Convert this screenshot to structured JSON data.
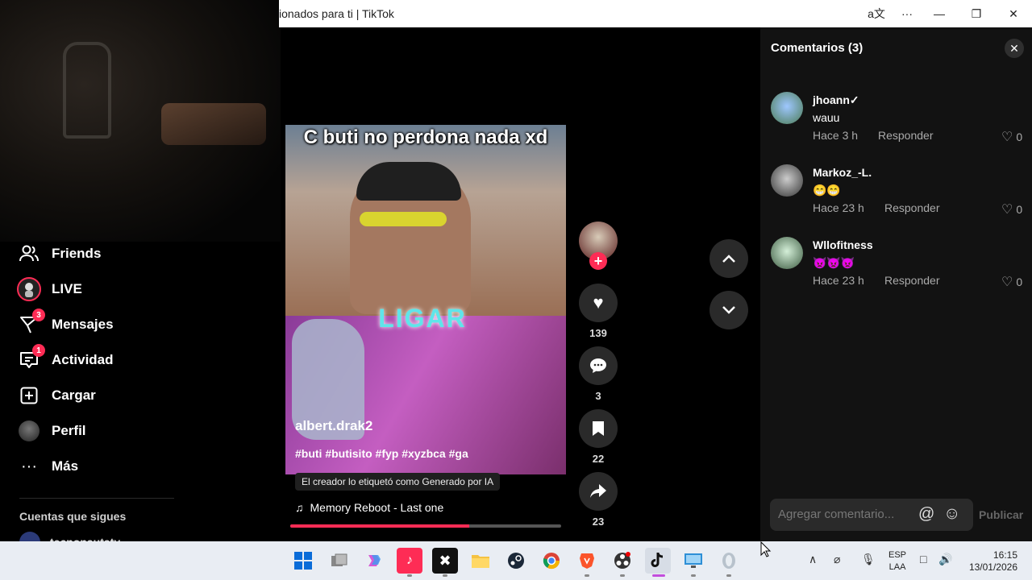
{
  "window": {
    "title": "ionados para ti | TikTok"
  },
  "nav": {
    "items": [
      {
        "label": "Friends",
        "icon": "friends-icon"
      },
      {
        "label": "LIVE",
        "icon": "live-icon"
      },
      {
        "label": "Mensajes",
        "icon": "messages-icon",
        "badge": "3"
      },
      {
        "label": "Actividad",
        "icon": "activity-icon",
        "badge": "1"
      },
      {
        "label": "Cargar",
        "icon": "upload-icon"
      },
      {
        "label": "Perfil",
        "icon": "profile-avatar"
      },
      {
        "label": "Más",
        "icon": "more-icon"
      }
    ],
    "following_title": "Cuentas que sigues",
    "following": [
      {
        "name": "tecnonautatv"
      }
    ]
  },
  "video": {
    "caption_top": "C buti no perdona nada xd",
    "overlay_text": "LIGAR",
    "author": "albert.drak2",
    "hashtags": "#buti #butisito #fyp #xyzbca #ga",
    "ai_label": "El creador lo etiquetó como Generado por IA",
    "music": "Memory Reboot - Last one",
    "progress": 0.66,
    "likes": "139",
    "comments": "3",
    "saves": "22",
    "shares": "23"
  },
  "comments_panel": {
    "title": "Comentarios",
    "count": "(3)",
    "reply_label": "Responder",
    "comments": [
      {
        "user": "jhoann✓",
        "text": "wauu",
        "time": "Hace 3 h",
        "likes": "0"
      },
      {
        "user": "Markoz_-L.",
        "text": "😁😁",
        "time": "Hace 23 h",
        "likes": "0"
      },
      {
        "user": "Wllofitness",
        "text": "👿👿👿",
        "time": "Hace 23 h",
        "likes": "0"
      }
    ],
    "input_placeholder": "Agregar comentario...",
    "publish_label": "Publicar"
  },
  "taskbar": {
    "lang_top": "ESP",
    "lang_bottom": "LAA",
    "time": "16:15",
    "date": "13/01/2026"
  },
  "colors": {
    "accent": "#fe2c55",
    "panel_bg": "#121212"
  }
}
